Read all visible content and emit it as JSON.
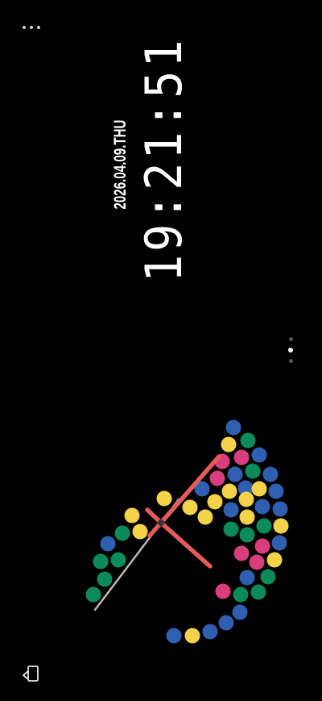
{
  "top_menu": {
    "icon": "more-horizontal-icon"
  },
  "clock": {
    "date": "2026.04.09.THU",
    "time": "19:21:51"
  },
  "page_indicator": {
    "count": 3,
    "active_index": 1
  },
  "dot_clock": {
    "colors": {
      "blue": "#2f5fb0",
      "yellow": "#f4d34a",
      "green": "#0b8a5a",
      "pink": "#d93d7c",
      "hand": "#e55b5b",
      "second_hand": "#b8b8b8",
      "center": "#333333"
    },
    "time": {
      "hours": 19,
      "minutes": 21,
      "seconds": 51
    }
  },
  "bottom_bar": {
    "rotate_icon": "screen-rotation-icon"
  }
}
